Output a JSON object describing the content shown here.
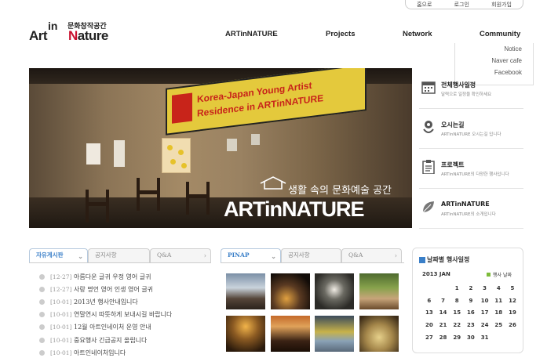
{
  "topbar": {
    "items": [
      "홈으로",
      "로그인",
      "회원가입"
    ]
  },
  "logo": {
    "art": "Art",
    "in": "in",
    "nature_n": "N",
    "nature_rest": "ature",
    "korean": "문화창작공간"
  },
  "nav": {
    "items": [
      "ARTinNATURE",
      "Projects",
      "Network",
      "Community"
    ],
    "dropdown": [
      "Notice",
      "Naver cafe",
      "Facebook"
    ]
  },
  "hero": {
    "banner_line1": "Korea-Japan Young Artist",
    "banner_line2": "Residence in ARTinNATURE",
    "slogan": "생활 속의 문화예술 공간",
    "brand": "ARTinNATURE"
  },
  "quicklinks": [
    {
      "title": "전체행사일정",
      "sub": "달력으로 일정을 확인하세요",
      "icon": "calendar-icon"
    },
    {
      "title": "오시는길",
      "sub": "ARTinNATURE 오시는길 입니다",
      "icon": "map-pin-icon"
    },
    {
      "title": "프로젝트",
      "sub": "ARTinNATURE의 다양한 행사입니다",
      "icon": "clipboard-icon"
    },
    {
      "title": "ARTinNATURE",
      "sub": "ARTinNATURE의 소개입니다",
      "icon": "leaf-icon"
    }
  ],
  "board": {
    "tabs": [
      "자유게시판",
      "공지사항",
      "Q&A"
    ],
    "posts": [
      {
        "date": "[12-27]",
        "title": "아름다운 글귀 우정 영어 글귀"
      },
      {
        "date": "[12-27]",
        "title": "사랑 명언 영어 인생 영어 글귀"
      },
      {
        "date": "[10-01]",
        "title": "2013년 행사안내입니다"
      },
      {
        "date": "[10-01]",
        "title": "연말연시 따뜻하게 보내시길 바랍니다"
      },
      {
        "date": "[10-01]",
        "title": "12월 아트인네이처 운영 안내"
      },
      {
        "date": "[10-01]",
        "title": "중요행사 긴급공지 올립니다"
      },
      {
        "date": "[10-01]",
        "title": "아트인네이처입니다"
      }
    ]
  },
  "gallery": {
    "tabs": [
      "PINAP",
      "공지사항",
      "Q&A"
    ],
    "thumb_count_note": ""
  },
  "calendar": {
    "title": "날짜별 행사일정",
    "month": "2013 JAN",
    "legend": "행사 날짜",
    "weeks": [
      [
        "",
        "",
        "1",
        "2",
        "3",
        "4",
        "5"
      ],
      [
        "6",
        "7",
        "8",
        "9",
        "10",
        "11",
        "12"
      ],
      [
        "13",
        "14",
        "15",
        "16",
        "17",
        "18",
        "19"
      ],
      [
        "20",
        "21",
        "22",
        "23",
        "24",
        "25",
        "26"
      ],
      [
        "27",
        "28",
        "29",
        "30",
        "31",
        "",
        ""
      ]
    ]
  },
  "colors": {
    "accent": "#3a7fc8",
    "logo_red": "#c8102e",
    "banner_yellow": "#e4c93c",
    "event_green": "#7dbb3a"
  }
}
